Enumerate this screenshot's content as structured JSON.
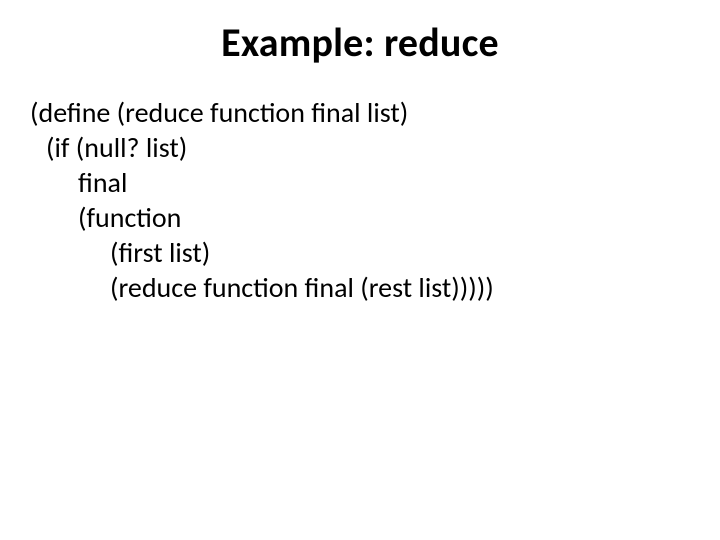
{
  "slide": {
    "title": "Example: reduce",
    "code": {
      "l1": "(define (reduce function final list)",
      "l2": "(if (null? list)",
      "l3": "final",
      "l4": "(function",
      "l5": "(first list)",
      "l6": "(reduce function final (rest list)))))"
    }
  }
}
